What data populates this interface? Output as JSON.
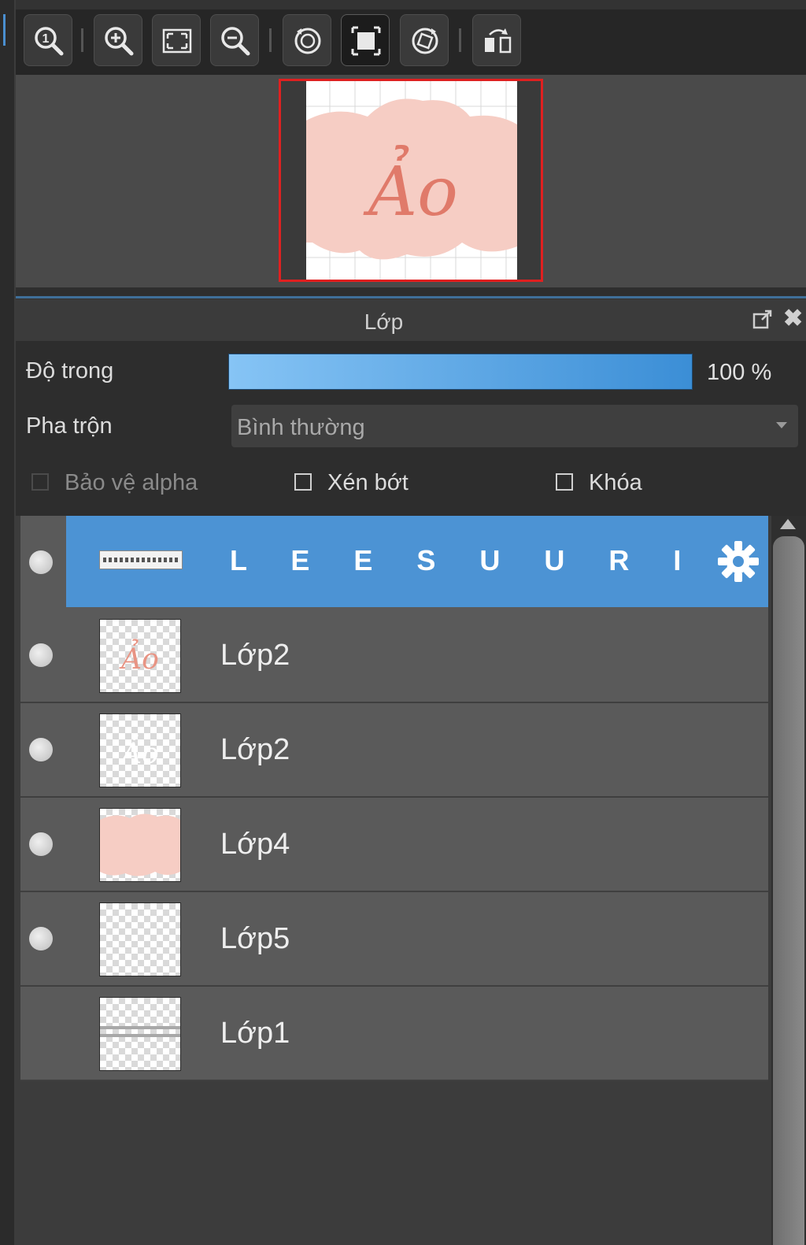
{
  "toolbar": {
    "buttons": [
      {
        "name": "zoom-actual-size",
        "icon": "zoom-1-icon"
      },
      {
        "name": "zoom-in",
        "icon": "zoom-in-icon"
      },
      {
        "name": "fit-screen",
        "icon": "fit-screen-icon"
      },
      {
        "name": "zoom-out",
        "icon": "zoom-out-icon"
      },
      {
        "name": "rotate-left",
        "icon": "rotate-left-icon"
      },
      {
        "name": "reset-view",
        "icon": "fit-canvas-icon",
        "active": true
      },
      {
        "name": "rotate-right",
        "icon": "rotate-right-icon"
      },
      {
        "name": "flip-horizontal",
        "icon": "flip-horizontal-icon"
      }
    ]
  },
  "panel": {
    "title": "Lớp"
  },
  "properties": {
    "opacity_label": "Độ trong",
    "opacity_value": "100 %",
    "opacity_fraction": 1.0,
    "blend_label": "Pha trộn",
    "blend_value": "Bình thường",
    "alpha_protect_label": "Bảo vệ alpha",
    "clip_label": "Xén bớt",
    "lock_label": "Khóa"
  },
  "layers": [
    {
      "name": "L E E S U U R I N",
      "selected": true,
      "visible": true
    },
    {
      "name": "Lớp2",
      "visible": true
    },
    {
      "name": "Lớp2",
      "visible": true
    },
    {
      "name": "Lớp4",
      "visible": true
    },
    {
      "name": "Lớp5",
      "visible": true
    },
    {
      "name": "Lớp1",
      "visible": false
    }
  ],
  "colors": {
    "accent": "#4c93d4",
    "canvas_pink": "#f6cdc4",
    "text_pink": "#e07a6a",
    "highlight_red": "#e02020"
  }
}
